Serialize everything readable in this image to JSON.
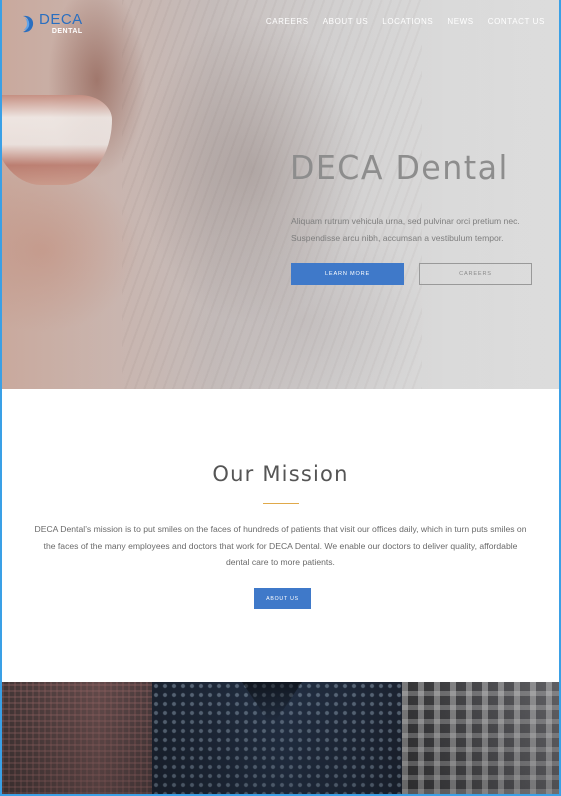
{
  "brand": {
    "logo_primary": "DECA",
    "logo_secondary": "DENTAL",
    "logo_color": "#2a6fc0"
  },
  "nav": {
    "items": [
      {
        "label": "CAREERS"
      },
      {
        "label": "ABOUT US"
      },
      {
        "label": "LOCATIONS"
      },
      {
        "label": "NEWS"
      },
      {
        "label": "CONTACT US"
      }
    ]
  },
  "hero": {
    "title": "DECA Dental",
    "text": "Aliquam rutrum vehicula urna, sed pulvinar orci pretium nec. Suspendisse arcu nibh, accumsan a vestibulum tempor.",
    "primary_button": "LEARN MORE",
    "secondary_button": "CAREERS",
    "image_icon": "smiling-woman-photo"
  },
  "mission": {
    "title": "Our Mission",
    "accent_color": "#e0a94a",
    "text": "DECA Dental’s mission is to put smiles on the faces of hundreds of patients that visit our offices daily, which in turn puts smiles on the faces of the many employees and doctors that work for DECA Dental. We enable our doctors to deliver quality, affordable dental care to more patients.",
    "button": "ABOUT US"
  },
  "colors": {
    "button_blue": "#3f79c9",
    "frame_border": "#3aa0e6"
  },
  "people_section": {
    "image_icon": "team-photo"
  }
}
